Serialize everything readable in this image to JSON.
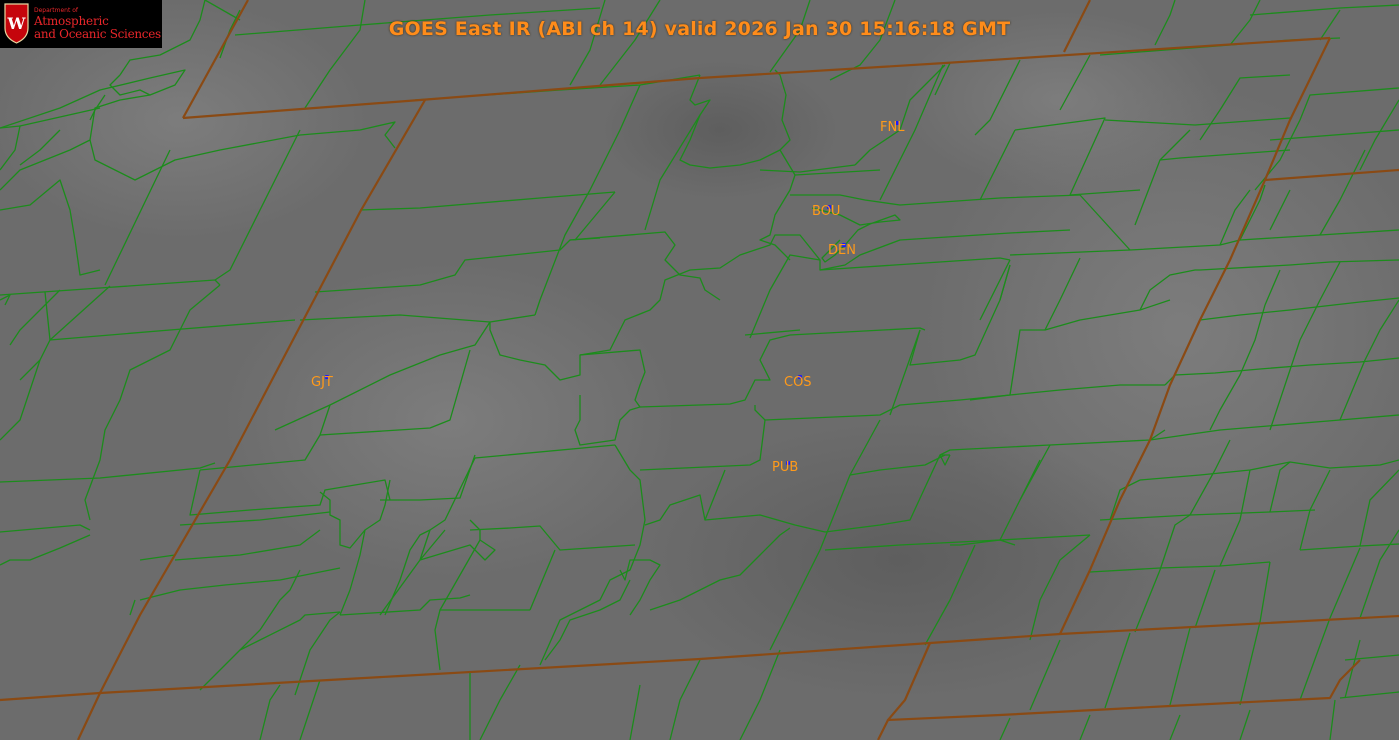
{
  "title": "GOES East IR (ABI ch 14) valid 2026 Jan 30 15:16:18 GMT",
  "logo": {
    "dept": "Department of",
    "line1": "Atmospheric",
    "line2": "and Oceanic Sciences",
    "emblem_letter": "W"
  },
  "stations": [
    {
      "id": "FNL"
    },
    {
      "id": "BOU"
    },
    {
      "id": "DEN"
    },
    {
      "id": "COS"
    },
    {
      "id": "PUB"
    },
    {
      "id": "GJT"
    }
  ],
  "colors": {
    "background": "#6e6e6e",
    "county_lines": "#1c8c1c",
    "state_lines": "#8a4a14",
    "station_labels": "#ff9a1a",
    "station_markers": "#1a1aff",
    "title": "#ff8c1a",
    "logo_text": "#e8262a"
  }
}
